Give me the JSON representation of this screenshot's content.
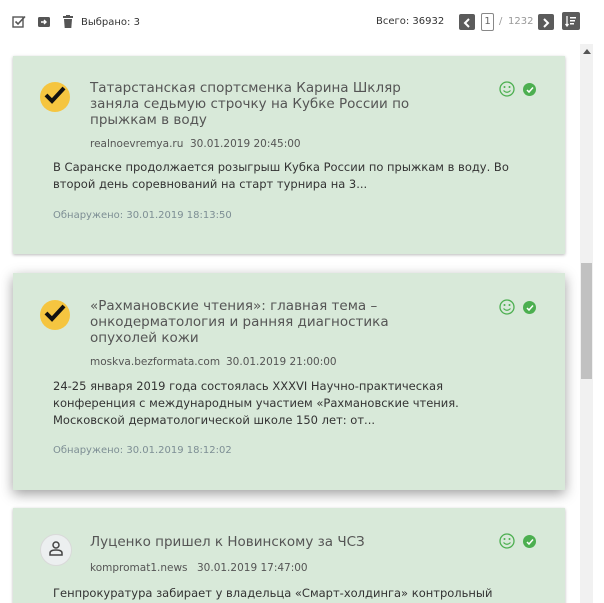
{
  "toolbar": {
    "selected_label": "Выбрано: 3",
    "total_label": "Всего: 36932",
    "page_current": "1",
    "page_separator": "/",
    "page_total": "1232",
    "icons": [
      "select-all-icon",
      "archive-icon",
      "delete-icon",
      "prev-page-icon",
      "next-page-icon",
      "sort-icon"
    ]
  },
  "articles": [
    {
      "title": "Татарстанская спортсменка Карина Шкляр заняла седьмую строчку на Кубке России по прыжкам в воду",
      "source": "realnoevremya.ru",
      "date": "30.01.2019 20:45:00",
      "snippet": "В Саранске продолжается розыгрыш Кубка России по прыжкам в воду. Во второй день соревнований на старт турнира на 3...",
      "found": "Обнаружено: 30.01.2019 18:13:50",
      "avatar": "check-icon",
      "selected": true
    },
    {
      "title": "«Рахмановские чтения»: главная тема – онкодерматология и ранняя диагностика опухолей кожи",
      "source": "moskva.bezformata.com",
      "date": "30.01.2019 21:00:00",
      "snippet": "24-25 января 2019 года состоялась XXXVI Научно-практическая конференция с международным участием «Рахмановские чтения. Московской дерматологической школе 150 лет: от...",
      "found": "Обнаружено: 30.01.2019 18:12:02",
      "avatar": "check-icon",
      "selected": true
    },
    {
      "title": "Луценко пришел к Новинскому за ЧСЗ",
      "source": "kompromat1.news",
      "date": "30.01.2019 17:47:00",
      "snippet": "Генпрокуратура забирает у владельца «Смарт-холдинга» контрольный пакет",
      "avatar": "person-icon",
      "selected": false
    }
  ],
  "colors": {
    "card_background": "#d8e9d9",
    "status_green": "#4caf50",
    "check_avatar": "#f5c540",
    "toolbar_button": "#5b5b5b"
  }
}
